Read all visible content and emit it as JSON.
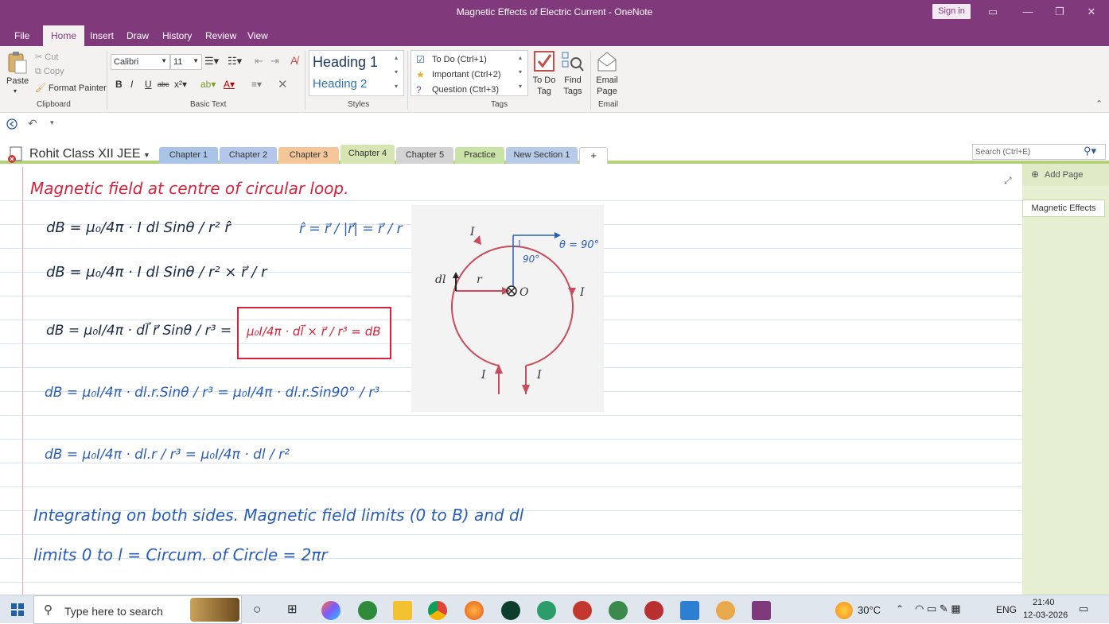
{
  "window": {
    "title": "Magnetic Effects of Electric Current - OneNote",
    "sign_in": "Sign in"
  },
  "menu": [
    "File",
    "Home",
    "Insert",
    "Draw",
    "History",
    "Review",
    "View"
  ],
  "ribbon": {
    "clipboard": {
      "paste": "Paste",
      "cut": "Cut",
      "copy": "Copy",
      "format_painter": "Format Painter",
      "label": "Clipboard"
    },
    "basic_text": {
      "font": "Calibri",
      "size": "11",
      "label": "Basic Text"
    },
    "styles": {
      "heading1": "Heading 1",
      "heading2": "Heading 2",
      "label": "Styles"
    },
    "tags": {
      "todo": "To Do (Ctrl+1)",
      "important": "Important (Ctrl+2)",
      "question": "Question (Ctrl+3)",
      "label": "Tags"
    },
    "todo_tag": "To Do\nTag",
    "find_tags": "Find\nTags",
    "email_page": "Email\nPage",
    "email_label": "Email"
  },
  "notebook": {
    "name": "Rohit Class XII JEE",
    "tabs": [
      {
        "label": "Chapter 1",
        "color": "#a9c4e6"
      },
      {
        "label": "Chapter 2",
        "color": "#b4c6ea"
      },
      {
        "label": "Chapter 3",
        "color": "#f5c69a"
      },
      {
        "label": "Chapter 4",
        "color": "#d6e6b3"
      },
      {
        "label": "Chapter 5",
        "color": "#d4d4d4"
      },
      {
        "label": "Practice",
        "color": "#c9e2a6"
      },
      {
        "label": "New Section 1",
        "color": "#b7cbe8"
      },
      {
        "label": "+",
        "color": "#ffffff"
      }
    ],
    "active_tab": "Chapter 4",
    "search_placeholder": "Search (Ctrl+E)"
  },
  "pages_pane": {
    "add_page": "Add Page",
    "pages": [
      "Magnetic Effects"
    ]
  },
  "note": {
    "title": "Magnetic field at centre of circular loop.",
    "eq1": "dB = μ₀/4π · I dl Sinθ / r² r̂",
    "eq_rhat": "r̂ = r⃗ / |r⃗| = r⃗ / r",
    "eq2": "dB = μ₀/4π · I dl Sinθ / r² × r⃗ / r",
    "eq3_left": "dB = μ₀I/4π · dl⃗ r⃗ Sinθ / r³ =",
    "eq3_box": "μ₀I/4π · dl⃗ × r⃗ / r³ = dB",
    "eq4": "dB = μ₀I/4π · dl.r.Sinθ / r³ = μ₀I/4π · dl.r.Sin90° / r³",
    "eq5": "dB = μ₀I/4π · dl.r / r³ = μ₀I/4π · dl / r²",
    "line6": "Integrating on both sides. Magnetic field limits (0 to B) and dl",
    "line7": "limits 0 to l = Circum. of Circle = 2πr",
    "figure": {
      "I_top": "I",
      "theta": "θ = 90°",
      "angle": "90°",
      "dl": "dl",
      "r": "r",
      "O": "O",
      "I_right": "I",
      "I_left": "I",
      "I_bottom": "I"
    }
  },
  "taskbar": {
    "search": "Type here to search",
    "temp": "30°C",
    "lang": "ENG",
    "time": "21:40",
    "date": "12-03-2026"
  }
}
